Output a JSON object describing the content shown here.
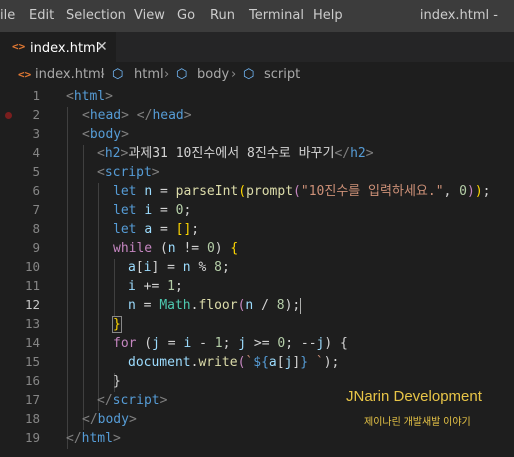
{
  "menubar": {
    "items": [
      "ile",
      "Edit",
      "Selection",
      "View",
      "Go",
      "Run",
      "Terminal",
      "Help"
    ],
    "window_title": "index.html -"
  },
  "tab": {
    "icon": "<>",
    "label": "index.html",
    "close": "✕"
  },
  "breadcrumb": {
    "html_icon": "<>",
    "items": [
      "index.html",
      "html",
      "body",
      "script"
    ]
  },
  "line_numbers": [
    "1",
    "2",
    "3",
    "4",
    "5",
    "6",
    "7",
    "8",
    "9",
    "10",
    "11",
    "12",
    "13",
    "14",
    "15",
    "16",
    "17",
    "18",
    "19"
  ],
  "active_line": 12,
  "code": {
    "l1": [
      "<",
      "html",
      ">"
    ],
    "l2": [
      "<",
      "head",
      ">",
      " ",
      "</",
      "head",
      ">"
    ],
    "l3": [
      "<",
      "body",
      ">"
    ],
    "l4": [
      "<",
      "h2",
      ">",
      "과제31 10진수에서 8진수로 바꾸기",
      "</",
      "h2",
      ">"
    ],
    "l5": [
      "<",
      "script",
      ">"
    ],
    "l6": [
      "let",
      " ",
      "n",
      " = ",
      "parseInt",
      "(",
      "prompt",
      "(",
      "\"10진수를 입력하세요.\"",
      ", ",
      "0",
      ")",
      ")",
      ";"
    ],
    "l7": [
      "let",
      " ",
      "i",
      " = ",
      "0",
      ";"
    ],
    "l8": [
      "let",
      " ",
      "a",
      " = ",
      "[]",
      ";"
    ],
    "l9": [
      "while",
      " (",
      "n",
      " != ",
      "0",
      ") ",
      "{"
    ],
    "l10": [
      "a",
      "[",
      "i",
      "] = ",
      "n",
      " % ",
      "8",
      ";"
    ],
    "l11": [
      "i",
      " += ",
      "1",
      ";"
    ],
    "l12": [
      "n",
      " = ",
      "Math",
      ".",
      "floor",
      "(",
      "n",
      " / ",
      "8",
      ");"
    ],
    "l13": [
      "}"
    ],
    "l14": [
      "for",
      " (",
      "j",
      " = ",
      "i",
      " - ",
      "1",
      "; ",
      "j",
      " >= ",
      "0",
      "; --",
      "j",
      ") {"
    ],
    "l15": [
      "document",
      ".",
      "write",
      "(",
      "`",
      "${",
      "a",
      "[",
      "j",
      "]",
      "}",
      " `",
      ");"
    ],
    "l16": [
      "}"
    ],
    "l17": [
      "</",
      "script",
      ">"
    ],
    "l18": [
      "</",
      "body",
      ">"
    ],
    "l19": [
      "</",
      "html",
      ">"
    ]
  },
  "watermark": {
    "title": "JNarin Development",
    "subtitle": "제이나린 개발새발 이야기"
  },
  "colors": {
    "tag": "#569cd6",
    "keyword": "#569cd6",
    "control": "#c586c0",
    "variable": "#9cdcfe",
    "function": "#dcdcaa",
    "string": "#ce9178",
    "number": "#b5cea8",
    "class": "#4ec9b0",
    "watermark": "#e8c547"
  }
}
